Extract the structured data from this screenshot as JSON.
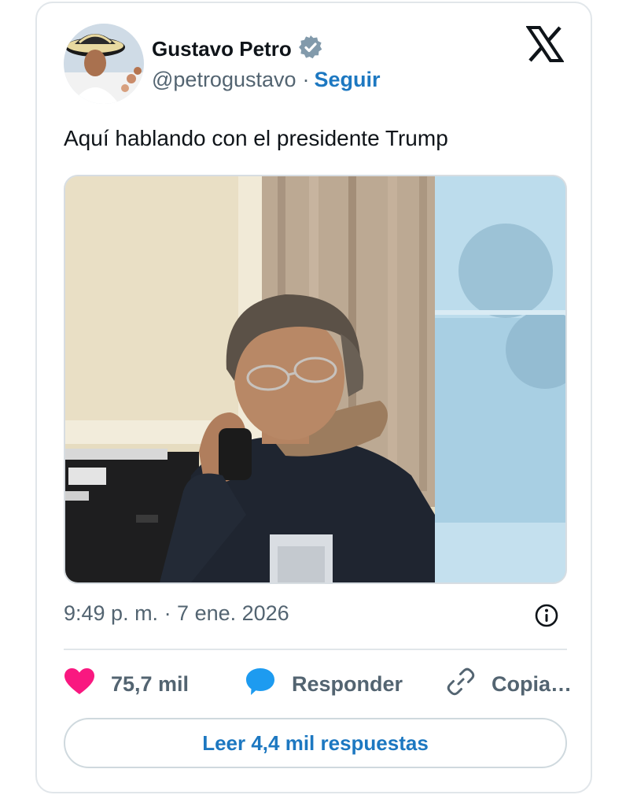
{
  "author": {
    "name": "Gustavo Petro",
    "handle": "@petrogustavo",
    "separator": "·",
    "follow_label": "Seguir",
    "verified": true
  },
  "tweet": {
    "text": "Aquí hablando con el presidente Trump",
    "timestamp": "9:49 p. m. · 7 ene. 2026"
  },
  "actions": {
    "likes_count": "75,7 mil",
    "reply_label": "Responder",
    "copy_label": "Copia…"
  },
  "replies_button_label": "Leer 4,4 mil respuestas",
  "icons": {
    "verified": "verified-badge-icon",
    "brand": "x-logo-icon",
    "info": "info-icon",
    "like": "heart-icon",
    "reply": "speech-bubble-icon",
    "copy": "link-icon"
  },
  "colors": {
    "accent": "#1d78c1",
    "like": "#f91880",
    "text": "#0f1419",
    "muted": "#536471",
    "border": "#e1e6ea"
  }
}
